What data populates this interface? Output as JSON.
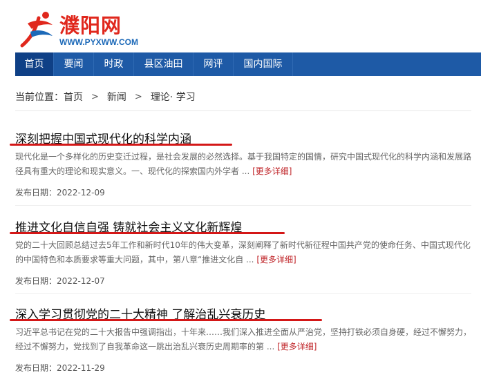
{
  "site": {
    "name": "濮阳网",
    "url": "WWW.PYXWW.COM",
    "brand_color": "#e0281d",
    "nav_color": "#1e5aa6"
  },
  "nav": {
    "items": [
      {
        "label": "首页",
        "active": true
      },
      {
        "label": "要闻"
      },
      {
        "label": "时政"
      },
      {
        "label": "县区油田"
      },
      {
        "label": "网评"
      },
      {
        "label": "国内国际"
      }
    ]
  },
  "breadcrumb": {
    "prefix": "当前位置：",
    "items": [
      "首页",
      "新闻",
      "理论· 学习"
    ],
    "separator": ">"
  },
  "articles": [
    {
      "title": "深刻把握中国式现代化的科学内涵",
      "summary": "现代化是一个多样化的历史变迁过程，是社会发展的必然选择。基于我国特定的国情，研究中国式现代化的科学内涵和发展路径具有重大的理论和现实意义。一、现代化的探索国内外学者",
      "dots": " ... ",
      "more": "[更多详细]",
      "date_label": "发布日期：",
      "date": "2022-12-09"
    },
    {
      "title": "推进文化自信自强 铸就社会主义文化新辉煌",
      "summary": "党的二十大回顾总结过去5年工作和新时代10年的伟大变革，深刻阐释了新时代新征程中国共产党的使命任务、中国式现代化的中国特色和本质要求等重大问题，其中，第八章“推进文化自",
      "dots": " ... ",
      "more": "[更多详细]",
      "date_label": "发布日期：",
      "date": "2022-12-07"
    },
    {
      "title": "深入学习贯彻党的二十大精神 了解治乱兴衰历史",
      "summary": "习近平总书记在党的二十大报告中强调指出，十年来……我们深入推进全面从严治党，坚持打铁必须自身硬，经过不懈努力，经过不懈努力，党找到了自我革命这一跳出治乱兴衰历史周期率的第",
      "dots": " ... ",
      "more": "[更多详细]",
      "date_label": "发布日期：",
      "date": "2022-11-29"
    }
  ]
}
